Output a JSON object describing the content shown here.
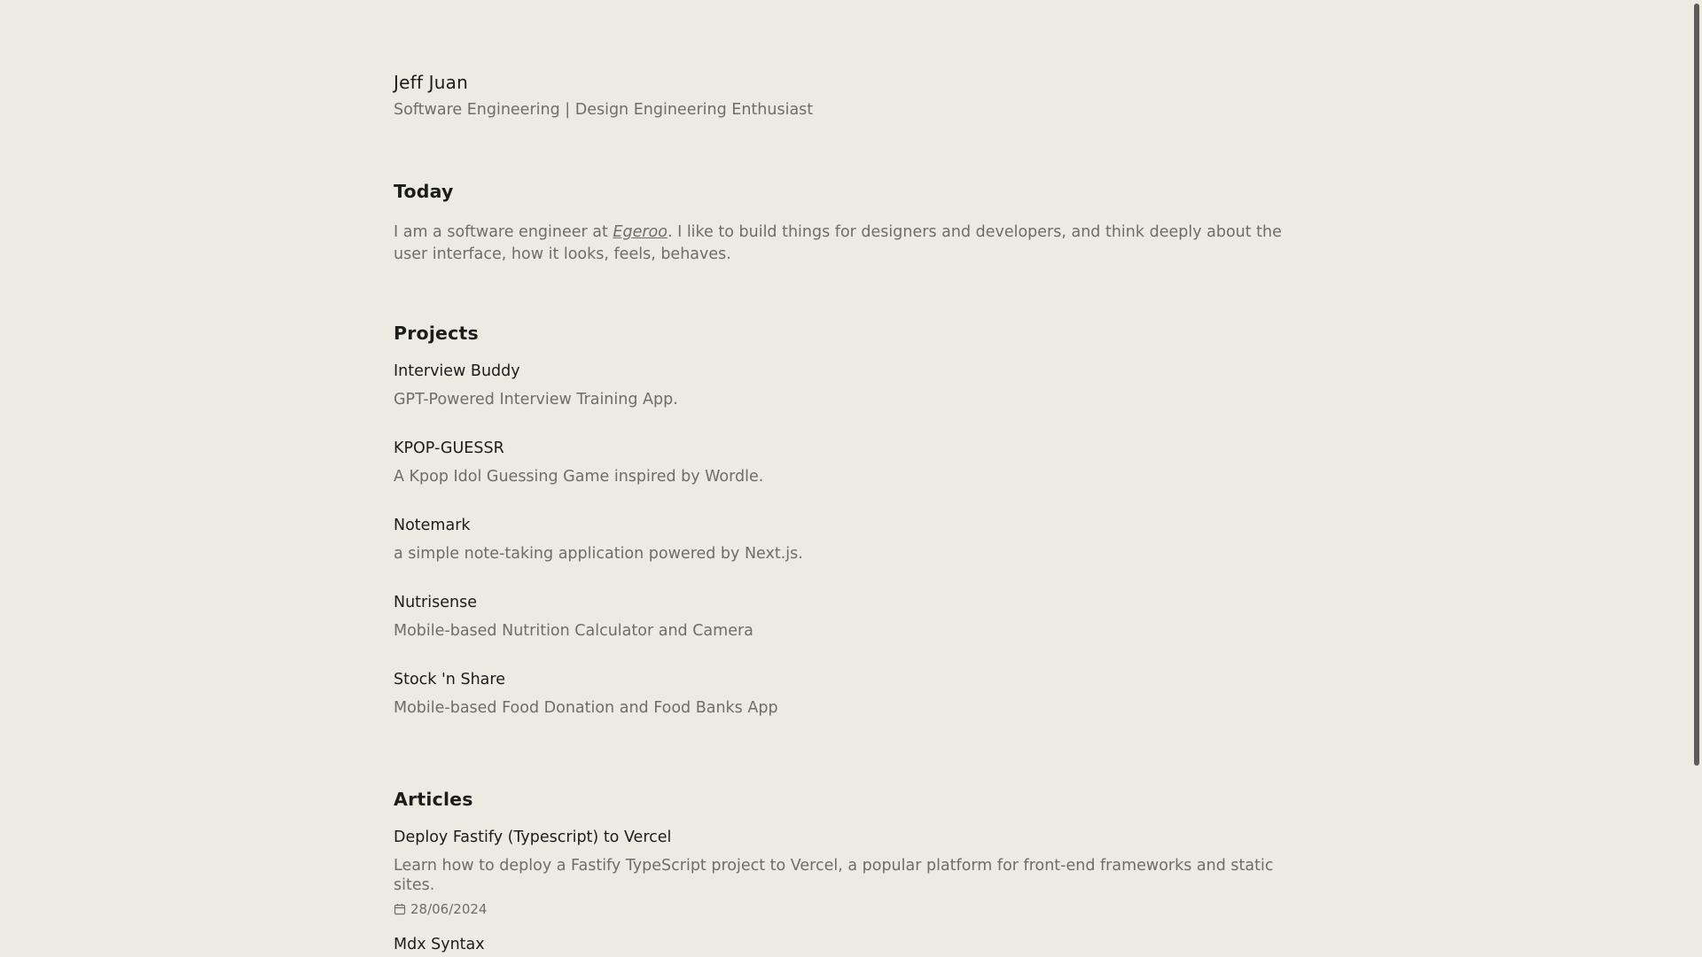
{
  "header": {
    "name": "Jeff Juan",
    "tagline": "Software Engineering | Design Engineering Enthusiast"
  },
  "today": {
    "title": "Today",
    "text_before": "I am a software engineer at ",
    "company": "Egeroo",
    "text_after": ". I like to build things for designers and developers, and think deeply about the user interface, how it looks, feels, behaves."
  },
  "projects": {
    "title": "Projects",
    "items": [
      {
        "name": "Interview Buddy",
        "description": "GPT-Powered Interview Training App."
      },
      {
        "name": "KPOP-GUESSR",
        "description": "A Kpop Idol Guessing Game inspired by Wordle."
      },
      {
        "name": "Notemark",
        "description": "a simple note-taking application powered by Next.js."
      },
      {
        "name": "Nutrisense",
        "description": "Mobile-based Nutrition Calculator and Camera"
      },
      {
        "name": "Stock 'n Share",
        "description": "Mobile-based Food Donation and Food Banks App"
      }
    ]
  },
  "articles": {
    "title": "Articles",
    "items": [
      {
        "name": "Deploy Fastify (Typescript) to Vercel",
        "description": "Learn how to deploy a Fastify TypeScript project to Vercel, a popular platform for front-end frameworks and static sites.",
        "date": "28/06/2024"
      },
      {
        "name": "Mdx Syntax"
      }
    ]
  },
  "icons": {
    "date": "calendar-icon"
  },
  "colors": {
    "background": "#ecebe1",
    "text_primary": "#1c1c1a",
    "text_secondary": "#6e6d66"
  }
}
